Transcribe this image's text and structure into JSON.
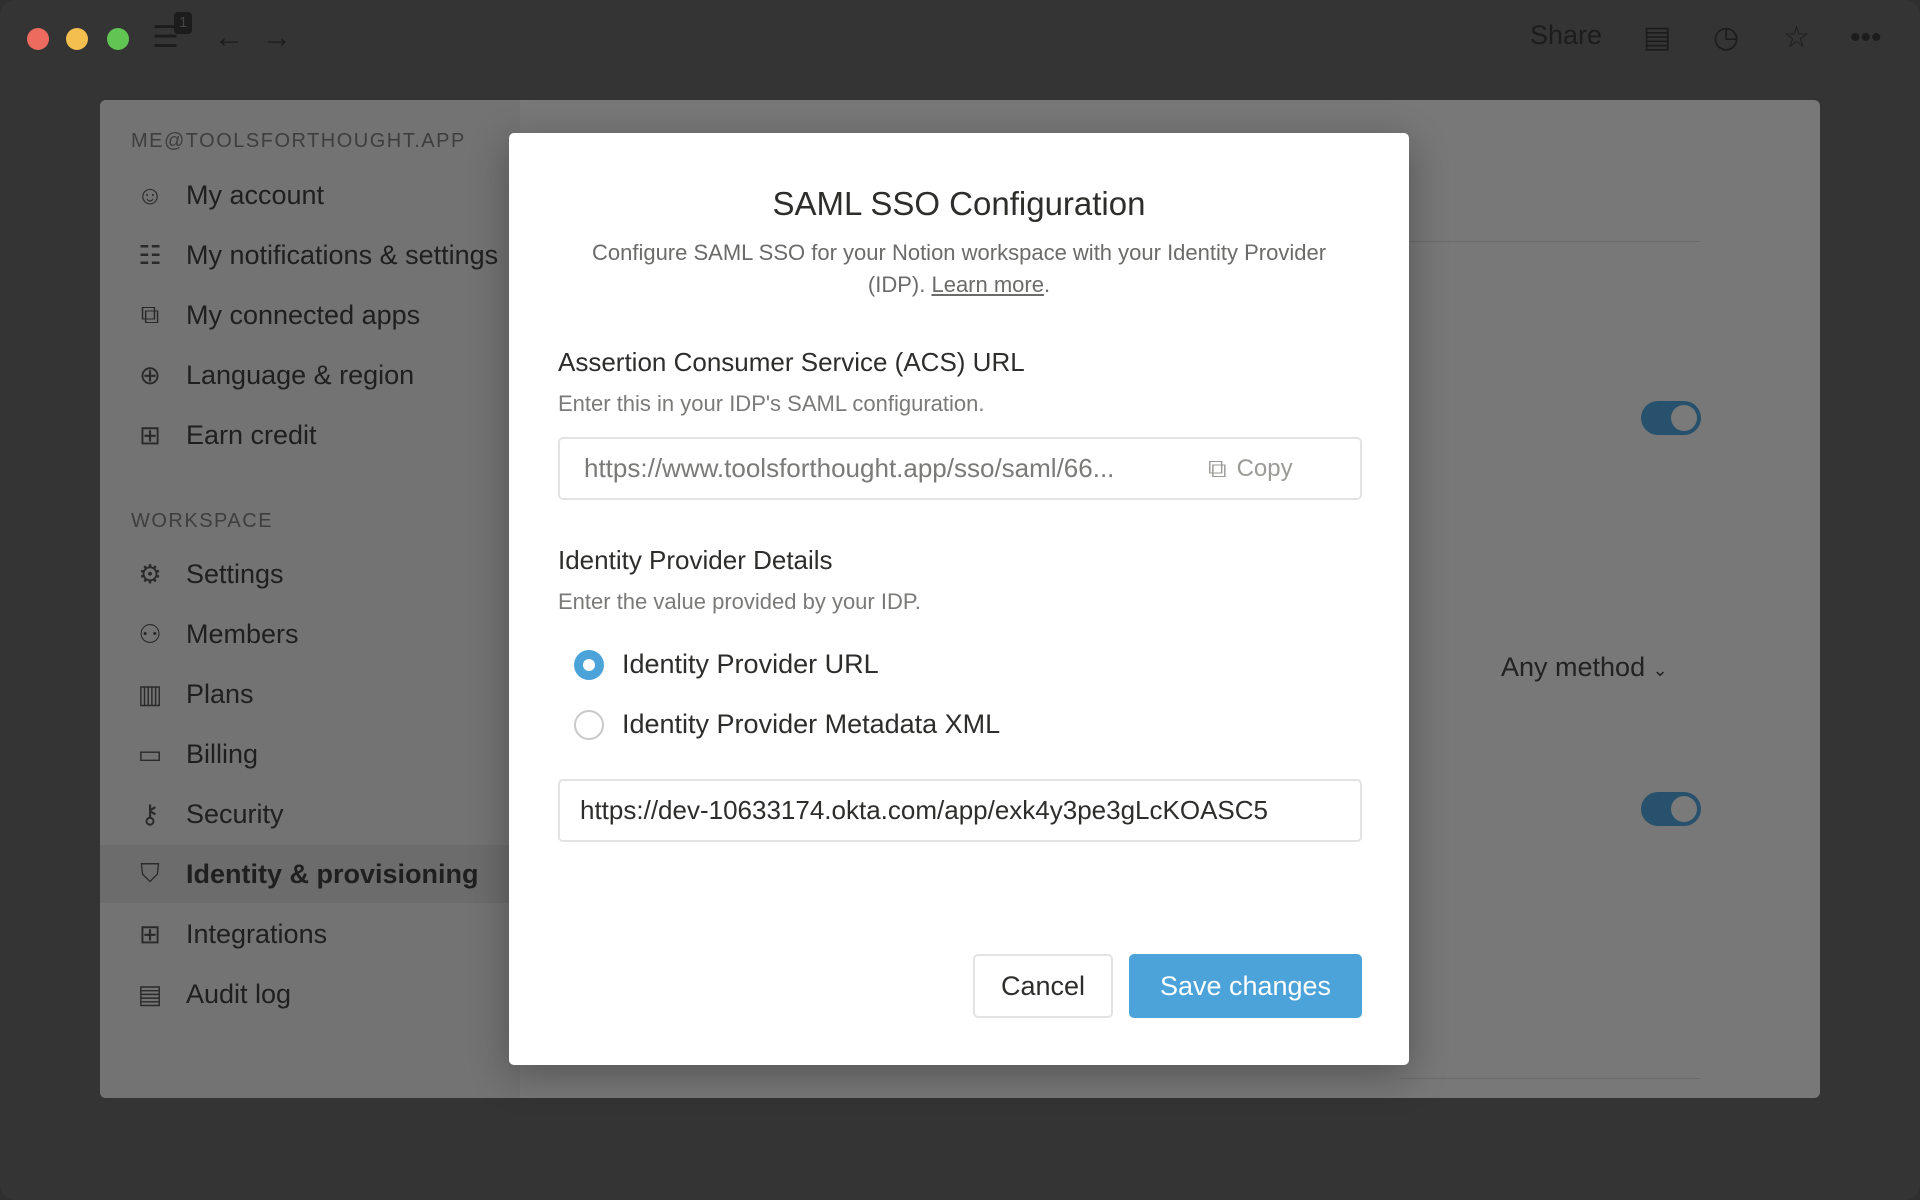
{
  "titlebar": {
    "tab_count": "1",
    "share": "Share",
    "icons": [
      "sidebar-icon",
      "back-arrow-icon",
      "forward-arrow-icon",
      "comment-icon",
      "clock-icon",
      "star-icon",
      "more-icon"
    ]
  },
  "sidebar": {
    "account_header": "ME@TOOLSFORTHOUGHT.APP",
    "account_items": [
      {
        "label": "My account",
        "icon": "avatar"
      },
      {
        "label": "My notifications & settings",
        "icon": "sliders-icon"
      },
      {
        "label": "My connected apps",
        "icon": "external-link-icon"
      },
      {
        "label": "Language & region",
        "icon": "globe-icon"
      },
      {
        "label": "Earn credit",
        "icon": "gift-icon"
      }
    ],
    "workspace_header": "WORKSPACE",
    "workspace_items": [
      {
        "label": "Settings",
        "icon": "gear-icon"
      },
      {
        "label": "Members",
        "icon": "people-icon"
      },
      {
        "label": "Plans",
        "icon": "map-icon"
      },
      {
        "label": "Billing",
        "icon": "credit-card-icon"
      },
      {
        "label": "Security",
        "icon": "key-icon"
      },
      {
        "label": "Identity & provisioning",
        "icon": "shield-icon",
        "active": true
      },
      {
        "label": "Integrations",
        "icon": "grid-icon"
      },
      {
        "label": "Audit log",
        "icon": "scroll-icon"
      }
    ]
  },
  "background": {
    "method_select": "Any method",
    "toggles": [
      true,
      true
    ]
  },
  "modal": {
    "title": "SAML SSO Configuration",
    "subtitle": "Configure SAML SSO for your Notion workspace with your Identity Provider (IDP).",
    "learn_more": "Learn more",
    "acs_heading": "Assertion Consumer Service (ACS) URL",
    "acs_hint": "Enter this in your IDP's SAML configuration.",
    "acs_url": "https://www.toolsforthought.app/sso/saml/66...",
    "copy": "Copy",
    "idp_heading": "Identity Provider Details",
    "idp_hint": "Enter the value provided by your IDP.",
    "options": [
      {
        "label": "Identity Provider URL",
        "selected": true
      },
      {
        "label": "Identity Provider Metadata XML",
        "selected": false
      }
    ],
    "idp_value": "https://dev-10633174.okta.com/app/exk4y3pe3gLcKOASC5",
    "cancel": "Cancel",
    "save": "Save changes",
    "accent": "#4ba3d9"
  }
}
